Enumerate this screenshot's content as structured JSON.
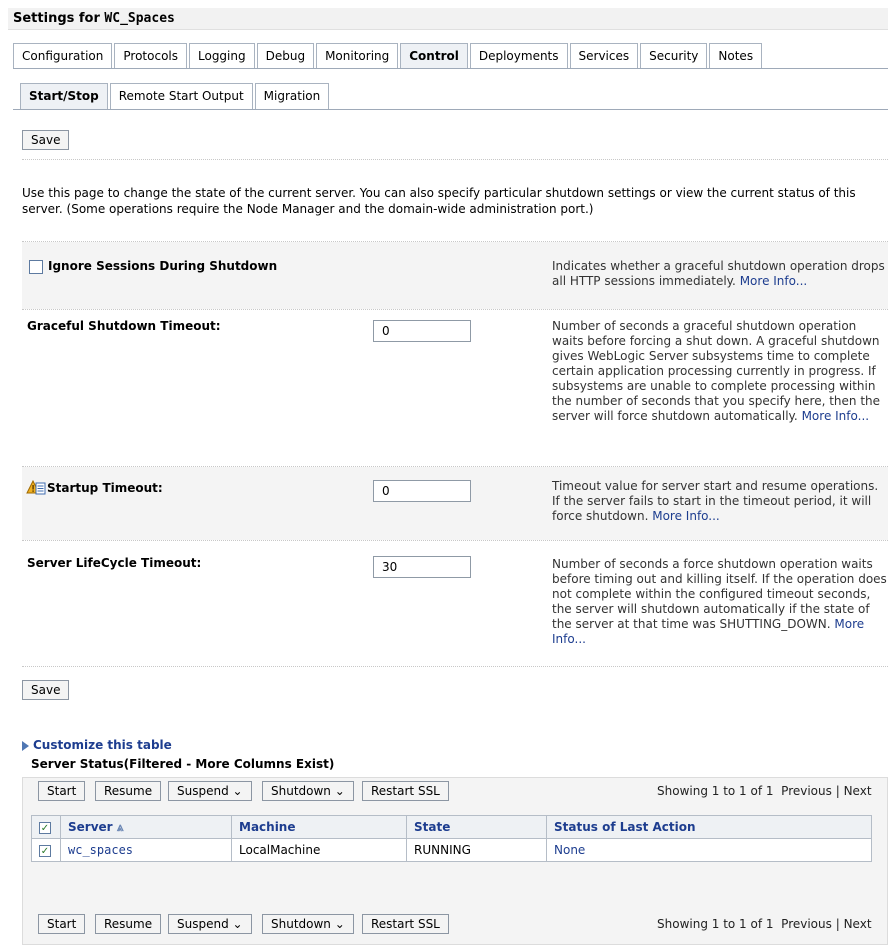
{
  "header": {
    "title_prefix": "Settings for ",
    "title_server": "WC_Spaces"
  },
  "tabs": [
    "Configuration",
    "Protocols",
    "Logging",
    "Debug",
    "Monitoring",
    "Control",
    "Deployments",
    "Services",
    "Security",
    "Notes"
  ],
  "active_tab": "Control",
  "subtabs": [
    "Start/Stop",
    "Remote Start Output",
    "Migration"
  ],
  "active_subtab": "Start/Stop",
  "save_label": "Save",
  "description": "Use this page to change the state of the current server. You can also specify particular shutdown settings or view the current status of this server. (Some operations require the Node Manager and the domain-wide administration port.)",
  "fields": {
    "ignore_sessions": {
      "label": "Ignore Sessions During Shutdown",
      "help": "Indicates whether a graceful shutdown operation drops all HTTP sessions immediately.",
      "more": "More Info..."
    },
    "graceful_timeout": {
      "label": "Graceful Shutdown Timeout:",
      "value": "0",
      "help": "Number of seconds a graceful shutdown operation waits before forcing a shut down. A graceful shutdown gives WebLogic Server subsystems time to complete certain application processing currently in progress. If subsystems are unable to complete processing within the number of seconds that you specify here, then the server will force shutdown automatically.",
      "more": "More Info..."
    },
    "startup_timeout": {
      "label": "Startup Timeout:",
      "value": "0",
      "help": "Timeout value for server start and resume operations. If the server fails to start in the timeout period, it will force shutdown.",
      "more": "More Info..."
    },
    "lifecycle_timeout": {
      "label": "Server LifeCycle Timeout:",
      "value": "30",
      "help": "Number of seconds a force shutdown operation waits before timing out and killing itself. If the operation does not complete within the configured timeout seconds, the server will shutdown automatically if the state of the server at that time was SHUTTING_DOWN.",
      "more": "More Info..."
    }
  },
  "customize_link": "Customize this table",
  "table": {
    "title": "Server Status(Filtered - More Columns Exist)",
    "buttons": {
      "start": "Start",
      "resume": "Resume",
      "suspend": "Suspend",
      "shutdown": "Shutdown",
      "restart_ssl": "Restart SSL"
    },
    "paging": {
      "showing": "Showing 1 to 1 of 1",
      "previous": "Previous",
      "next": "Next"
    },
    "columns": [
      "Server",
      "Machine",
      "State",
      "Status of Last Action"
    ],
    "rows": [
      {
        "server": "wc_spaces",
        "machine": "LocalMachine",
        "state": "RUNNING",
        "status": "None"
      }
    ]
  },
  "colors": {
    "link": "#1d3d8f",
    "panel": "#f4f4f4",
    "border": "#a9b3c0"
  }
}
